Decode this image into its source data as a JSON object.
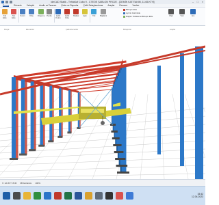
{
  "window": {
    "title": "ideCAD Statik - TehtaKaf Cubo 9 - CTEÖE ŞABLON PROJE - [ZEMİN KAT/TAKIM, 11.65.KTH]"
  },
  "menubar": {
    "items": [
      "Dosya",
      "Düzenle",
      "Yerleştir",
      "Analiz ve Tasarım",
      "Çizim ve Raporlar",
      "Çelik Detaylandırma",
      "Araçlar",
      "Pencere",
      "Yardım"
    ],
    "active_index": 0
  },
  "ribbon": {
    "buttons": [
      {
        "label": "Kat\nEkle",
        "icon": "add-floor-icon",
        "color": "#e6a23a"
      },
      {
        "label": "Aks\nEkle",
        "icon": "add-axis-icon",
        "color": "#d9534f"
      },
      {
        "label": "Kolon",
        "icon": "column-icon",
        "color": "#4a7fc1"
      },
      {
        "label": "Kiriş",
        "icon": "beam-icon",
        "color": "#4a7fc1"
      },
      {
        "label": "Döşeme",
        "icon": "slab-icon",
        "color": "#7bb05a"
      },
      {
        "label": "Perde",
        "icon": "wall-icon",
        "color": "#888"
      },
      {
        "label": "Çelik\nKolon",
        "icon": "steel-column-icon",
        "color": "#2e6cb8"
      },
      {
        "label": "Çelik\nKiriş",
        "icon": "steel-beam-icon",
        "color": "#c0392b"
      },
      {
        "label": "Makas",
        "icon": "truss-icon",
        "color": "#c0392b"
      },
      {
        "label": "Aşık",
        "icon": "purlin-icon",
        "color": "#d6c43a"
      },
      {
        "label": "Yük",
        "icon": "load-icon",
        "color": "#3aa0d6"
      },
      {
        "label": "Bağlantı",
        "icon": "connection-icon",
        "color": "#999"
      }
    ],
    "side_commands": [
      {
        "label": "Birleşim Ekle",
        "color": "#c0392b"
      },
      {
        "label": "Ayrıntı Görüntüle",
        "color": "#2e6cb8"
      },
      {
        "label": "Düğüm Noktasına Birleşim Ekle",
        "color": "#7bb05a"
      }
    ],
    "right_buttons": [
      {
        "label": "Ölçü",
        "icon": "dimension-icon",
        "color": "#555"
      },
      {
        "label": "Yazı",
        "icon": "text-icon",
        "color": "#555"
      },
      {
        "label": "Ara",
        "icon": "search-icon",
        "color": "#2e6cb8"
      }
    ],
    "groups": [
      "Dosya",
      "Elemanlar",
      "Çelik Elemanlar",
      "Birleşimler",
      "Araçlar"
    ]
  },
  "status": {
    "coords": "X: 12.45  Y: 8.30",
    "mode": "3B Görünüm",
    "zoom": "100%"
  },
  "taskbar": {
    "apps": [
      {
        "icon": "start-icon",
        "color": "#1f5fa8"
      },
      {
        "icon": "search-icon",
        "color": "#4a4a4a"
      },
      {
        "icon": "explorer-icon",
        "color": "#e8b538"
      },
      {
        "icon": "browser-icon",
        "color": "#2f8f3f"
      },
      {
        "icon": "mail-icon",
        "color": "#2b74c9"
      },
      {
        "icon": "idecad-icon",
        "color": "#c0392b"
      },
      {
        "icon": "excel-icon",
        "color": "#217346"
      },
      {
        "icon": "word-icon",
        "color": "#2b579a"
      },
      {
        "icon": "folder-icon",
        "color": "#d9a12e"
      },
      {
        "icon": "settings-icon",
        "color": "#5e6b7a"
      },
      {
        "icon": "terminal-icon",
        "color": "#333"
      },
      {
        "icon": "media-icon",
        "color": "#d9534f"
      },
      {
        "icon": "chat-icon",
        "color": "#3e7bd6"
      }
    ],
    "time": "15:42",
    "date": "12.04.2023"
  },
  "scene": {
    "colors": {
      "column": "#2c78c8",
      "column_dark": "#1d5a99",
      "roof_truss": "#c63a2a",
      "rafter": "#d13b2b",
      "crane_beam": "#e2e24a",
      "crane": "#d9d03a",
      "bracing": "#5aa0d0",
      "ground_grid": "#c9c9c9"
    }
  }
}
